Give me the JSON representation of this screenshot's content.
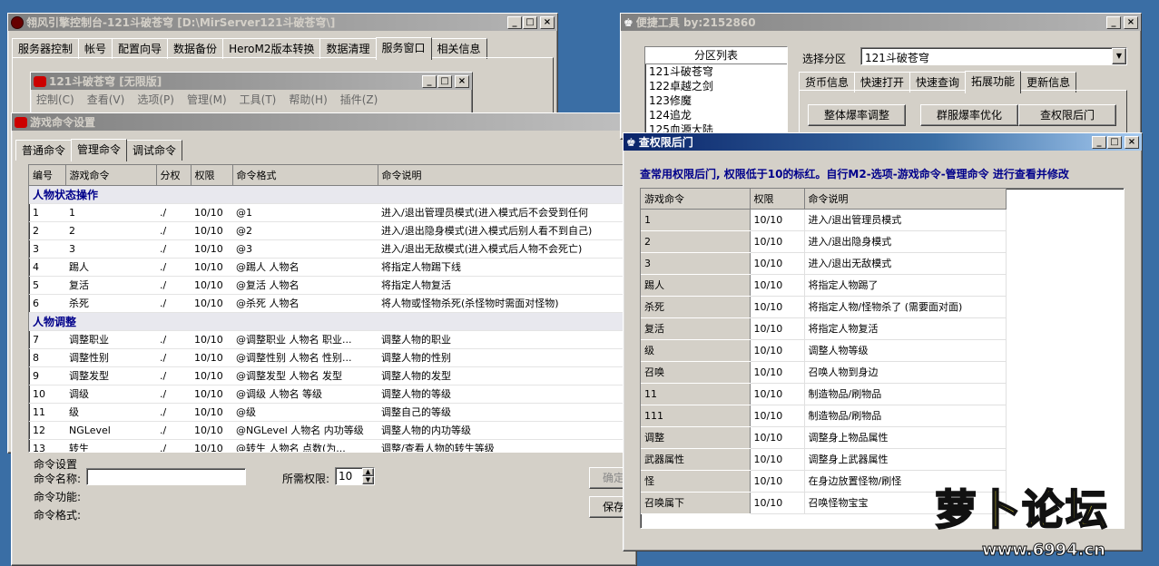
{
  "console": {
    "title": "翎风引擎控制台-121斗破苍穹 [D:\\MirServer121斗破苍穹\\]",
    "tabs": [
      "服务器控制",
      "帐号",
      "配置向导",
      "数据备份",
      "HeroM2版本转换",
      "数据清理",
      "服务窗口",
      "相关信息"
    ],
    "selected_tab": "服务窗口"
  },
  "inner": {
    "title": "121斗破苍穹 [无限版]",
    "menu": [
      "控制(C)",
      "查看(V)",
      "选项(P)",
      "管理(M)",
      "工具(T)",
      "帮助(H)",
      "插件(Z)"
    ]
  },
  "gamecmd": {
    "title": "游戏命令设置",
    "tabs": [
      "普通命令",
      "管理命令",
      "调试命令"
    ],
    "selected_tab": "管理命令",
    "columns": [
      "编号",
      "游戏命令",
      "分权",
      "权限",
      "命令格式",
      "命令说明"
    ],
    "groups": [
      {
        "name": "人物状态操作",
        "rows": [
          [
            "1",
            "1",
            "./",
            "10/10",
            "@1",
            "进入/退出管理员模式(进入模式后不会受到任何"
          ],
          [
            "2",
            "2",
            "./",
            "10/10",
            "@2",
            "进入/退出隐身模式(进入模式后别人看不到自己)"
          ],
          [
            "3",
            "3",
            "./",
            "10/10",
            "@3",
            "进入/退出无敌模式(进入模式后人物不会死亡)"
          ],
          [
            "4",
            "踢人",
            "./",
            "10/10",
            "@踢人 人物名",
            "将指定人物踢下线"
          ],
          [
            "5",
            "复活",
            "./",
            "10/10",
            "@复活 人物名",
            "将指定人物复活"
          ],
          [
            "6",
            "杀死",
            "./",
            "10/10",
            "@杀死 人物名",
            "将人物或怪物杀死(杀怪物时需面对怪物)"
          ]
        ]
      },
      {
        "name": "人物调整",
        "rows": [
          [
            "7",
            "调整职业",
            "./",
            "10/10",
            "@调整职业 人物名 职业...",
            "调整人物的职业"
          ],
          [
            "8",
            "调整性别",
            "./",
            "10/10",
            "@调整性别 人物名 性别...",
            "调整人物的性别"
          ],
          [
            "9",
            "调整发型",
            "./",
            "10/10",
            "@调整发型 人物名 发型",
            "调整人物的发型"
          ],
          [
            "10",
            "调级",
            "./",
            "10/10",
            "@调级 人物名 等级",
            "调整人物的等级"
          ],
          [
            "11",
            "级",
            "./",
            "10/10",
            "@级",
            "调整自己的等级"
          ],
          [
            "12",
            "NGLevel",
            "./",
            "10/10",
            "@NGLevel 人物名 内功等级",
            "调整人物的内功等级"
          ],
          [
            "13",
            "转生",
            "./",
            "10/10",
            "@转生 人物名 点数(为...",
            "调整/查看人物的转生等级"
          ]
        ]
      }
    ],
    "settings": {
      "group_label": "命令设置",
      "name_label": "命令名称:",
      "name_value": "",
      "perm_label": "所需权限:",
      "perm_value": "10",
      "func_label": "命令功能:",
      "format_label": "命令格式:",
      "ok_button": "确定",
      "save_button": "保存"
    }
  },
  "tools": {
    "title": "便捷工具  by:2152860",
    "partition_header": "分区列表",
    "partitions": [
      "121斗破苍穹",
      "122卓越之剑",
      "123修魔",
      "124追龙",
      "125血源大陆"
    ],
    "select_label": "选择分区",
    "select_value": "121斗破苍穹",
    "tabs": [
      "货币信息",
      "快速打开",
      "快速查询",
      "拓展功能",
      "更新信息"
    ],
    "selected_tab": "拓展功能",
    "buttons": [
      "整体爆率调整",
      "群服爆率优化",
      "查权限后门"
    ]
  },
  "perm": {
    "title": "查权限后门",
    "notice": "查常用权限后门, 权限低于10的标红。自行M2-选项-游戏命令-管理命令 进行查看并修改",
    "columns": [
      "游戏命令",
      "权限",
      "命令说明"
    ],
    "rows": [
      [
        "1",
        "10/10",
        "进入/退出管理员模式"
      ],
      [
        "2",
        "10/10",
        "进入/退出隐身模式"
      ],
      [
        "3",
        "10/10",
        "进入/退出无敌模式"
      ],
      [
        "踢人",
        "10/10",
        "将指定人物踢了"
      ],
      [
        "杀死",
        "10/10",
        "将指定人物/怪物杀了 (需要面对面)"
      ],
      [
        "复活",
        "10/10",
        "将指定人物复活"
      ],
      [
        "级",
        "10/10",
        "调整人物等级"
      ],
      [
        "召唤",
        "10/10",
        "召唤人物到身边"
      ],
      [
        "11",
        "10/10",
        "制造物品/刷物品"
      ],
      [
        "111",
        "10/10",
        "制造物品/刷物品"
      ],
      [
        "调整",
        "10/10",
        "调整身上物品属性"
      ],
      [
        "武器属性",
        "10/10",
        "调整身上武器属性"
      ],
      [
        "怪",
        "10/10",
        "在身边放置怪物/刷怪"
      ],
      [
        "召唤属下",
        "10/10",
        "召唤怪物宝宝"
      ]
    ]
  },
  "watermark": {
    "text": "萝卜论坛",
    "url": "www.6994.cn"
  }
}
